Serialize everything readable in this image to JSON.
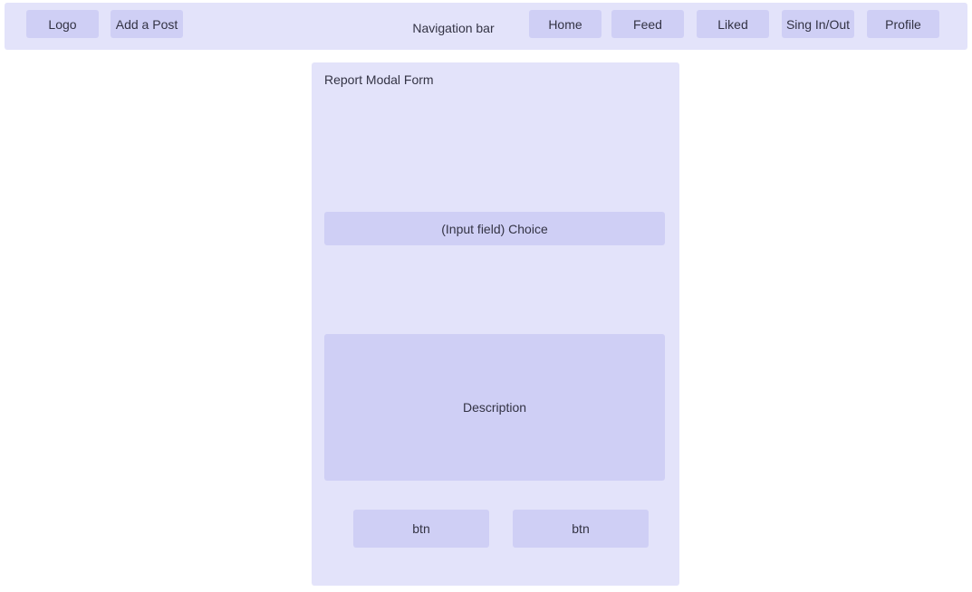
{
  "navbar": {
    "title": "Navigation bar",
    "logo_label": "Logo",
    "add_post_label": "Add a Post",
    "home_label": "Home",
    "feed_label": "Feed",
    "liked_label": "Liked",
    "sign_label": "Sing In/Out",
    "profile_label": "Profile"
  },
  "modal": {
    "title": "Report Modal Form",
    "choice_label": "(Input field) Choice",
    "description_label": "Description",
    "button_1_label": "btn",
    "button_2_label": "btn"
  }
}
